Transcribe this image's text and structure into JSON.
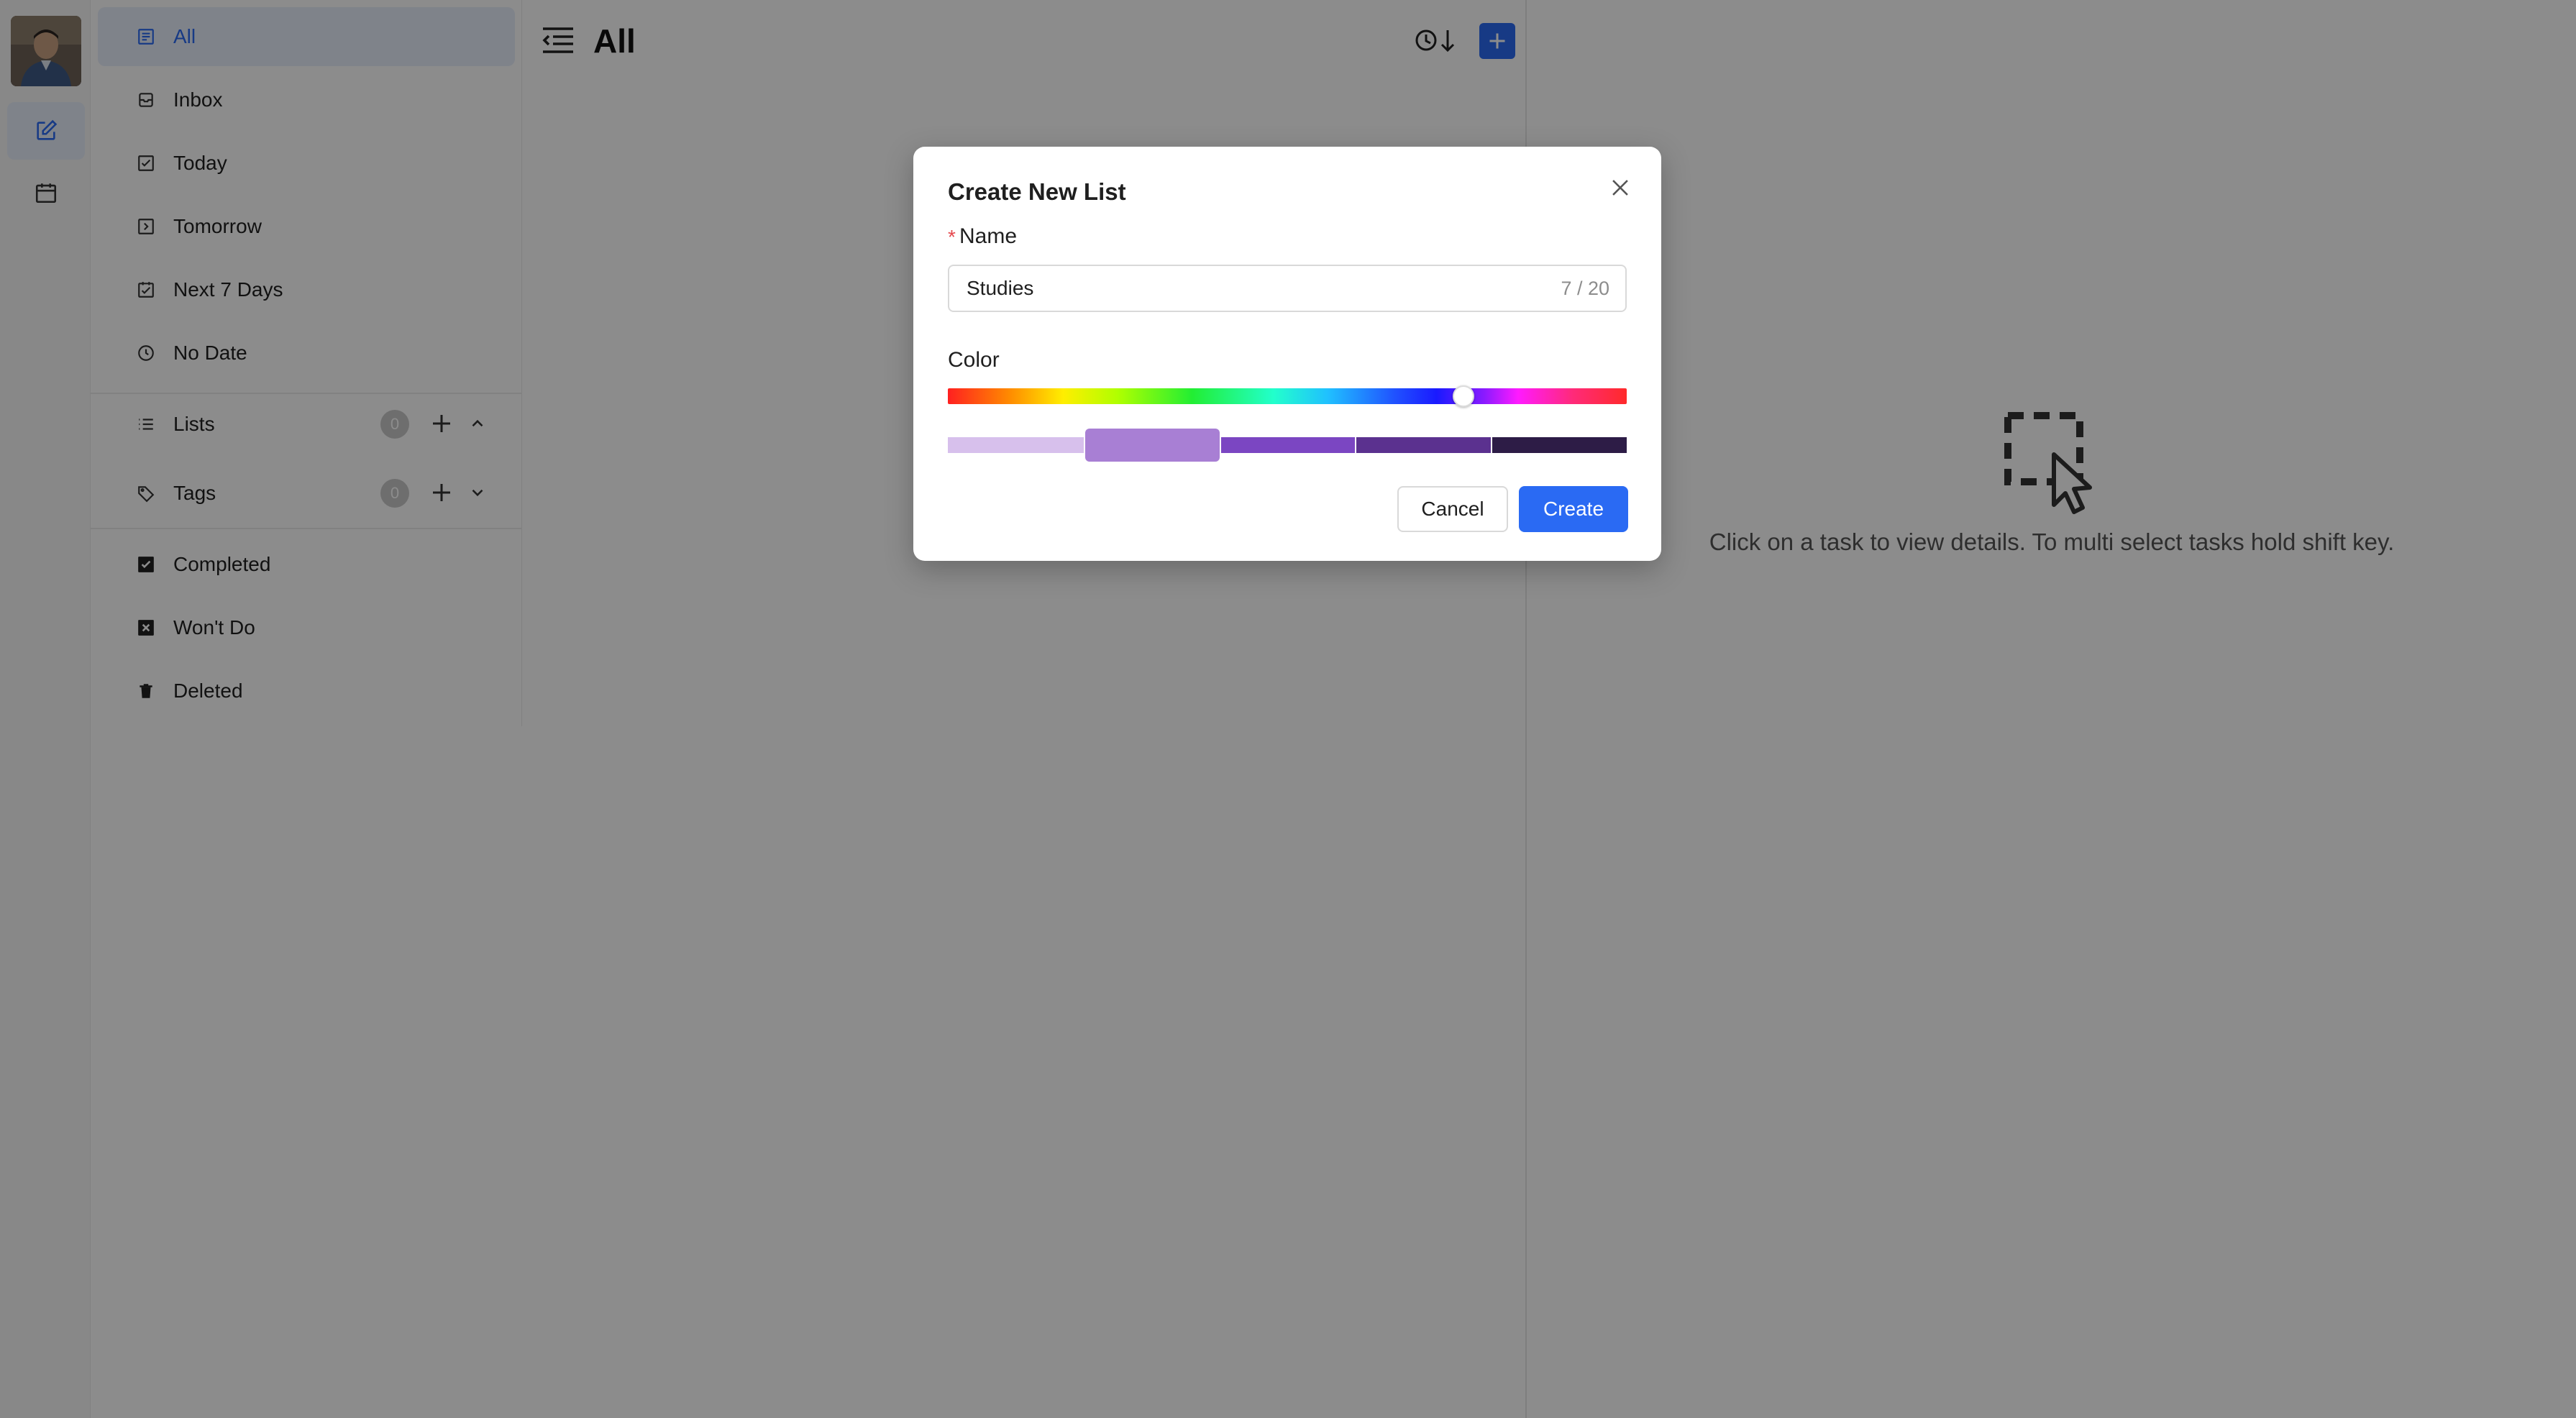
{
  "sidebar": {
    "nav": [
      {
        "label": "All",
        "icon": "list-doc-icon",
        "active": true
      },
      {
        "label": "Inbox",
        "icon": "inbox-icon"
      },
      {
        "label": "Today",
        "icon": "check-square-icon"
      },
      {
        "label": "Tomorrow",
        "icon": "arrow-square-icon"
      },
      {
        "label": "Next 7 Days",
        "icon": "calendar-check-icon"
      },
      {
        "label": "No Date",
        "icon": "clock-icon"
      }
    ],
    "lists": {
      "label": "Lists",
      "count": "0"
    },
    "tags": {
      "label": "Tags",
      "count": "0"
    },
    "bottom": [
      {
        "label": "Completed",
        "icon": "checkbox-filled-icon"
      },
      {
        "label": "Won't Do",
        "icon": "x-box-filled-icon"
      },
      {
        "label": "Deleted",
        "icon": "trash-icon"
      }
    ]
  },
  "main": {
    "title": "All"
  },
  "detail": {
    "empty_text": "Click on a task to view details. To multi select tasks hold shift key."
  },
  "modal": {
    "title": "Create New List",
    "required_mark": "*",
    "name_label": "Name",
    "name_value": "Studies",
    "name_count": "7 / 20",
    "color_label": "Color",
    "hue_position": 0.76,
    "swatches": [
      "#d7c0ec",
      "#a87fd4",
      "#7b46c2",
      "#5b318f",
      "#2d1c46"
    ],
    "selected_swatch": 1,
    "cancel_label": "Cancel",
    "create_label": "Create"
  },
  "colors": {
    "accent": "#2a6af3",
    "active_bg": "#e7eefc",
    "required": "#e5484d"
  }
}
